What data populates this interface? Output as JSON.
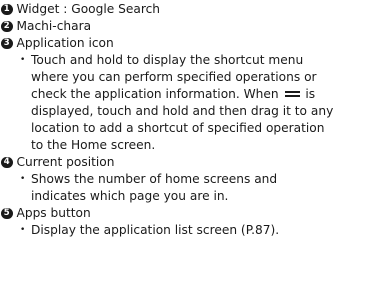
{
  "items": [
    {
      "number": "1",
      "title": "Widget : Google Search"
    },
    {
      "number": "2",
      "title": "Machi-chara"
    },
    {
      "number": "3",
      "title": "Application icon",
      "bullet_lines": [
        "Touch and hold to display the shortcut menu",
        "where you can perform specified operations or",
        "check the application information. When",
        "is",
        "displayed, touch and hold and then drag it to any",
        "location to add a shortcut of specified operation",
        "to the Home screen."
      ],
      "glyph_icon": "drag-handle-icon"
    },
    {
      "number": "4",
      "title": "Current position",
      "bullet_lines": [
        "Shows the number of home screens and",
        "indicates which page you are in."
      ]
    },
    {
      "number": "5",
      "title": "Apps button",
      "bullet_lines": [
        "Display the application list screen (P.87)."
      ]
    }
  ]
}
